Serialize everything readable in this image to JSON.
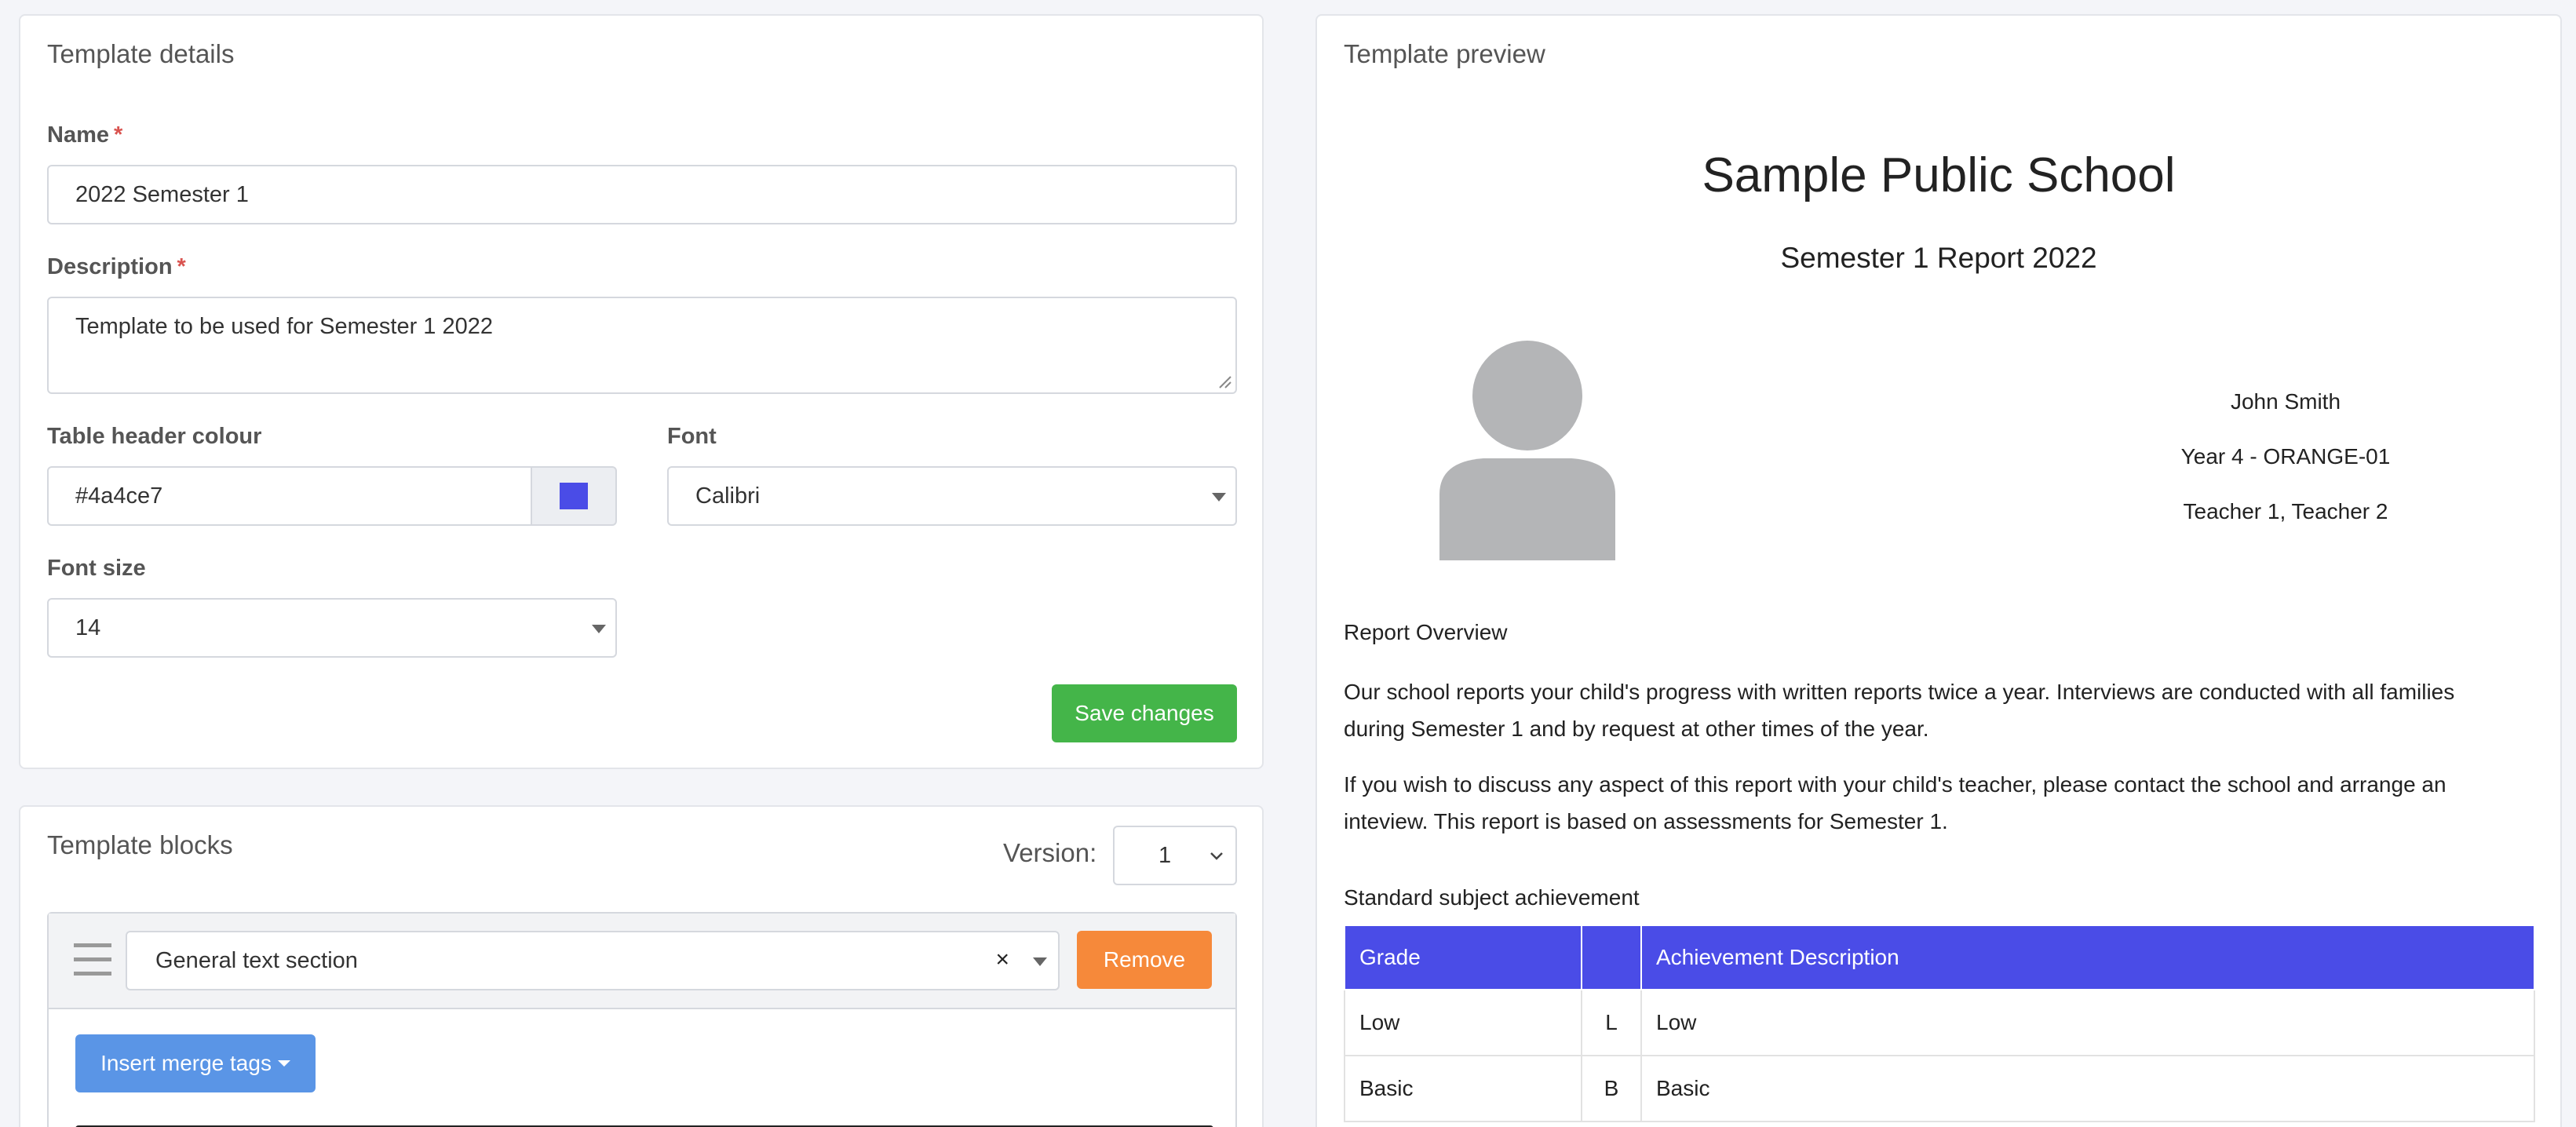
{
  "details": {
    "title": "Template details",
    "name_label": "Name",
    "required_mark": "*",
    "name_value": "2022 Semester 1",
    "description_label": "Description",
    "description_value": "Template to be used for Semester 1 2022",
    "header_colour_label": "Table header colour",
    "header_colour_value": "#4a4ce7",
    "swatch_color": "#4a4ce7",
    "font_label": "Font",
    "font_value": "Calibri",
    "font_size_label": "Font size",
    "font_size_value": "14",
    "save_button": "Save changes"
  },
  "blocks": {
    "title": "Template blocks",
    "version_label": "Version:",
    "version_value": "1",
    "block_type": "General text section",
    "clear_symbol": "×",
    "remove_button": "Remove",
    "merge_tags_button": "Insert merge tags"
  },
  "preview": {
    "title": "Template preview",
    "school_name": "Sample Public School",
    "report_title": "Semester 1 Report 2022",
    "student_name": "John Smith",
    "class_info": "Year 4 - ORANGE-01",
    "teachers": "Teacher 1, Teacher 2",
    "overview_heading": "Report Overview",
    "overview_line1": "Our school reports your child's progress with written reports twice a year. Interviews are conducted with all families",
    "overview_line2": "during Semester 1 and by request at other times of the year.",
    "discuss_line1": "If you wish to discuss any aspect of this report with your child's teacher, please contact the school and arrange an",
    "discuss_line2": "inteview. This report is based on assessments for Semester 1.",
    "achievement_heading": "Standard subject achievement",
    "table": {
      "headers": [
        "Grade",
        "",
        "Achievement Description"
      ],
      "rows": [
        [
          "Low",
          "L",
          "Low"
        ],
        [
          "Basic",
          "B",
          "Basic"
        ]
      ]
    }
  },
  "colors": {
    "accent_blue": "#4a4ce7",
    "save_green": "#44b549",
    "remove_orange": "#f6893a",
    "merge_blue": "#5a95e6"
  },
  "icons": {
    "drag_handle": "drag-handle-icon",
    "avatar": "avatar-placeholder-icon",
    "dropdown": "chevron-down-icon"
  }
}
